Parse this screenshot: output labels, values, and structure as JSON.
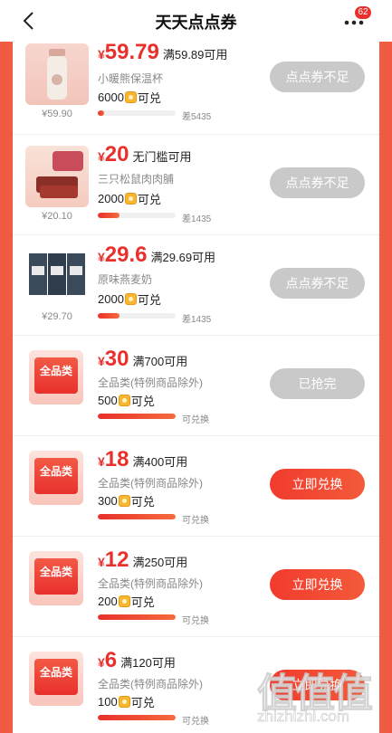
{
  "header": {
    "title": "天天点点券",
    "more_badge": "62"
  },
  "items": [
    {
      "kind": "product",
      "price": "59.79",
      "condition": "满59.89可用",
      "name": "小暖熊保温杯",
      "points": "6000",
      "points_suffix": "可兑",
      "orig_price": "¥59.90",
      "progress": 0.08,
      "note": "差5435",
      "button": "点点券不足",
      "button_state": "disabled"
    },
    {
      "kind": "product",
      "price": "20",
      "condition": "无门槛可用",
      "name": "三只松鼠肉肉脯",
      "points": "2000",
      "points_suffix": "可兑",
      "orig_price": "¥20.10",
      "progress": 0.28,
      "note": "差1435",
      "button": "点点券不足",
      "button_state": "disabled"
    },
    {
      "kind": "product",
      "price": "29.6",
      "condition": "满29.69可用",
      "name": "原味燕麦奶",
      "points": "2000",
      "points_suffix": "可兑",
      "orig_price": "¥29.70",
      "progress": 0.28,
      "note": "差1435",
      "button": "点点券不足",
      "button_state": "disabled"
    },
    {
      "kind": "coupon",
      "thumb_label": "全品类",
      "price": "30",
      "condition": "满700可用",
      "name": "全品类(特例商品除外)",
      "points": "500",
      "points_suffix": "可兑",
      "progress": 1.0,
      "note": "可兑换",
      "button": "已抢完",
      "button_state": "disabled"
    },
    {
      "kind": "coupon",
      "thumb_label": "全品类",
      "price": "18",
      "condition": "满400可用",
      "name": "全品类(特例商品除外)",
      "points": "300",
      "points_suffix": "可兑",
      "progress": 1.0,
      "note": "可兑换",
      "button": "立即兑换",
      "button_state": "active"
    },
    {
      "kind": "coupon",
      "thumb_label": "全品类",
      "price": "12",
      "condition": "满250可用",
      "name": "全品类(特例商品除外)",
      "points": "200",
      "points_suffix": "可兑",
      "progress": 1.0,
      "note": "可兑换",
      "button": "立即兑换",
      "button_state": "active"
    },
    {
      "kind": "coupon",
      "thumb_label": "全品类",
      "price": "6",
      "condition": "满120可用",
      "name": "全品类(特例商品除外)",
      "points": "100",
      "points_suffix": "可兑",
      "progress": 1.0,
      "note": "可兑换",
      "button": "立即兑换",
      "button_state": "active"
    }
  ],
  "currency_symbol": "¥",
  "watermark": {
    "chars": "值值值",
    "url": "zhizhizhi.com"
  },
  "colors": {
    "accent": "#e8302c",
    "disabled": "#c9c9c9",
    "background": "#f0523d"
  }
}
